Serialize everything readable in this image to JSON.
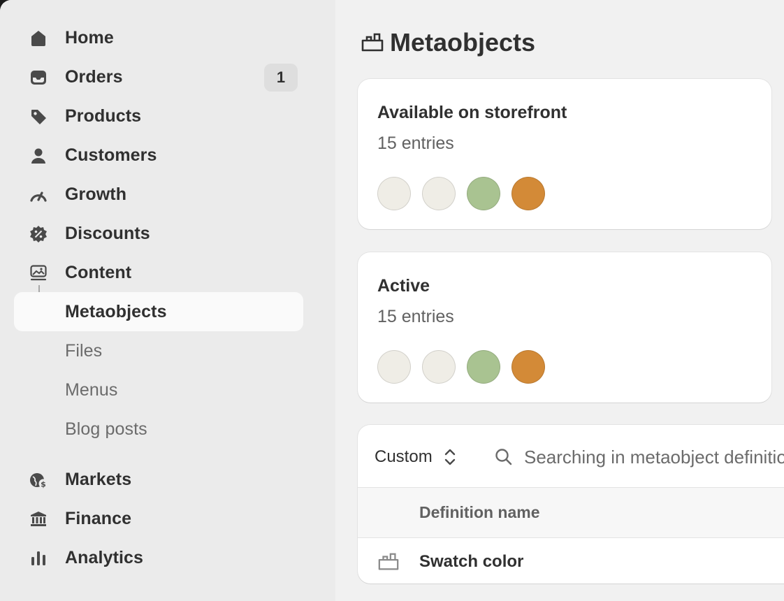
{
  "page": {
    "title": "Metaobjects",
    "title_icon": "metaobjects-icon"
  },
  "sidebar": {
    "items": [
      {
        "key": "home",
        "label": "Home",
        "icon": "home-icon"
      },
      {
        "key": "orders",
        "label": "Orders",
        "icon": "inbox-icon",
        "badge": "1"
      },
      {
        "key": "products",
        "label": "Products",
        "icon": "tag-icon"
      },
      {
        "key": "customers",
        "label": "Customers",
        "icon": "person-icon"
      },
      {
        "key": "growth",
        "label": "Growth",
        "icon": "gauge-icon"
      },
      {
        "key": "discounts",
        "label": "Discounts",
        "icon": "discount-icon"
      },
      {
        "key": "content",
        "label": "Content",
        "icon": "content-icon"
      }
    ],
    "content_subitems": [
      {
        "key": "metaobjects",
        "label": "Metaobjects",
        "selected": true
      },
      {
        "key": "files",
        "label": "Files"
      },
      {
        "key": "menus",
        "label": "Menus"
      },
      {
        "key": "blog_posts",
        "label": "Blog posts"
      }
    ],
    "bottom_items": [
      {
        "key": "markets",
        "label": "Markets",
        "icon": "globe-dollar-icon"
      },
      {
        "key": "finance",
        "label": "Finance",
        "icon": "bank-icon"
      },
      {
        "key": "analytics",
        "label": "Analytics",
        "icon": "bar-chart-icon"
      }
    ]
  },
  "cards": [
    {
      "title": "Available on storefront",
      "subtitle": "15 entries",
      "swatches": [
        "#efede6",
        "#efede6",
        "#a9c391",
        "#d38a37"
      ]
    },
    {
      "title": "Active",
      "subtitle": "15 entries",
      "swatches": [
        "#efede6",
        "#efede6",
        "#a9c391",
        "#d38a37"
      ]
    }
  ],
  "table": {
    "filter_select": "Custom",
    "search_placeholder": "Searching in metaobject definitions",
    "column_header": "Definition name",
    "rows": [
      {
        "name": "Swatch color",
        "icon": "metaobjects-icon"
      }
    ]
  }
}
